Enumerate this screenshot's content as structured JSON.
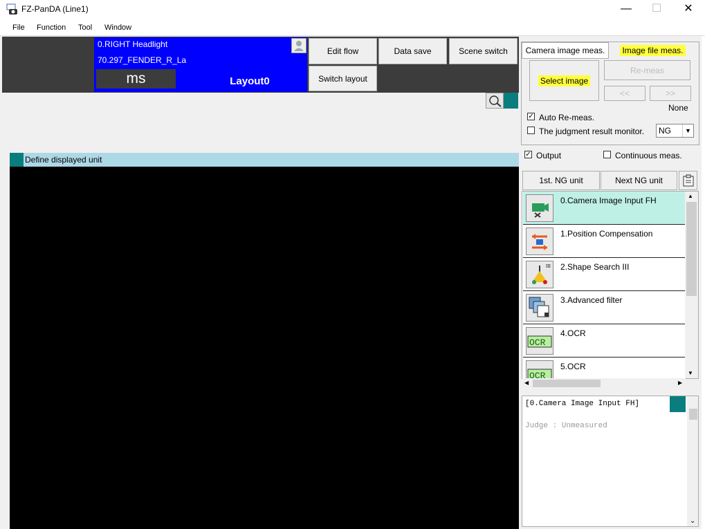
{
  "window": {
    "title": "FZ-PanDA (Line1)",
    "minimize": "—",
    "maximize": "☐",
    "close": "✕"
  },
  "menu": [
    "File",
    "Function",
    "Tool",
    "Window"
  ],
  "header": {
    "scene_line1": "0.RIGHT Headlight",
    "scene_line2": "70.297_FENDER_R_La",
    "time_unit": "ms",
    "layout_name": "Layout0",
    "buttons": {
      "edit_flow": "Edit flow",
      "data_save": "Data save",
      "scene_switch": "Scene switch",
      "switch_layout": "Switch layout"
    }
  },
  "main": {
    "define_unit_label": "Define displayed unit"
  },
  "measurement": {
    "tab_camera": "Camera image meas.",
    "tab_file": "Image file meas.",
    "select_image": "Select image",
    "remeas": "Re-meas",
    "prev": "<<",
    "next": ">>",
    "file_status": "None",
    "auto_remeas_label": "Auto Re-meas.",
    "auto_remeas_checked": true,
    "judgment_monitor_label": "The judgment result monitor.",
    "judgment_monitor_checked": false,
    "judgment_value": "NG",
    "output_label": "Output",
    "output_checked": true,
    "continuous_label": "Continuous meas.",
    "continuous_checked": false,
    "highlight_color": "#ffff3c"
  },
  "flow": {
    "first_ng": "1st. NG unit",
    "next_ng": "Next NG unit",
    "items": [
      {
        "label": "0.Camera Image Input FH",
        "icon": "camera-input-icon",
        "selected": true
      },
      {
        "label": "1.Position Compensation",
        "icon": "position-compensation-icon"
      },
      {
        "label": "2.Shape Search III",
        "icon": "shape-search-icon"
      },
      {
        "label": "3.Advanced filter",
        "icon": "advanced-filter-icon"
      },
      {
        "label": "4.OCR",
        "icon": "ocr-icon"
      },
      {
        "label": "5.OCR",
        "icon": "ocr-icon"
      }
    ],
    "selected_color": "#bff0e6",
    "ocr_text": "OCR"
  },
  "detail": {
    "title": "[0.Camera Image Input FH]",
    "judge": "Judge : Unmeasured"
  },
  "colors": {
    "scene_blue": "#0000ff",
    "dark_header": "#3c3c3c",
    "teal": "#0a7e7e",
    "unit_bar": "#add8e6"
  }
}
